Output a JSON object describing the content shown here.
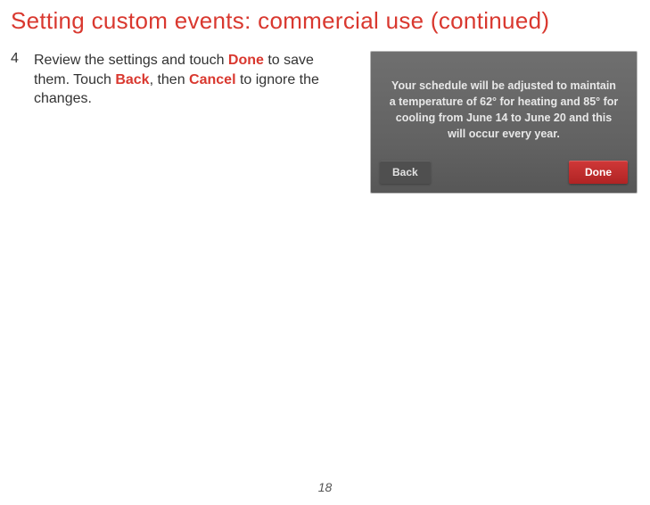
{
  "title": "Setting custom events: commercial use (continued)",
  "step": {
    "num": "4",
    "text_parts": {
      "p1": "Review the settings and touch ",
      "kw1": "Done",
      "p2": " to save them. Touch ",
      "kw2": "Back",
      "p3": ", then ",
      "kw3": "Cancel",
      "p4": " to ignore the changes."
    }
  },
  "device": {
    "message": "Your schedule will be adjusted to maintain a temperature of 62° for heating and 85° for cooling from June 14 to June 20 and this will occur every year.",
    "back_label": "Back",
    "done_label": "Done"
  },
  "page_number": "18"
}
